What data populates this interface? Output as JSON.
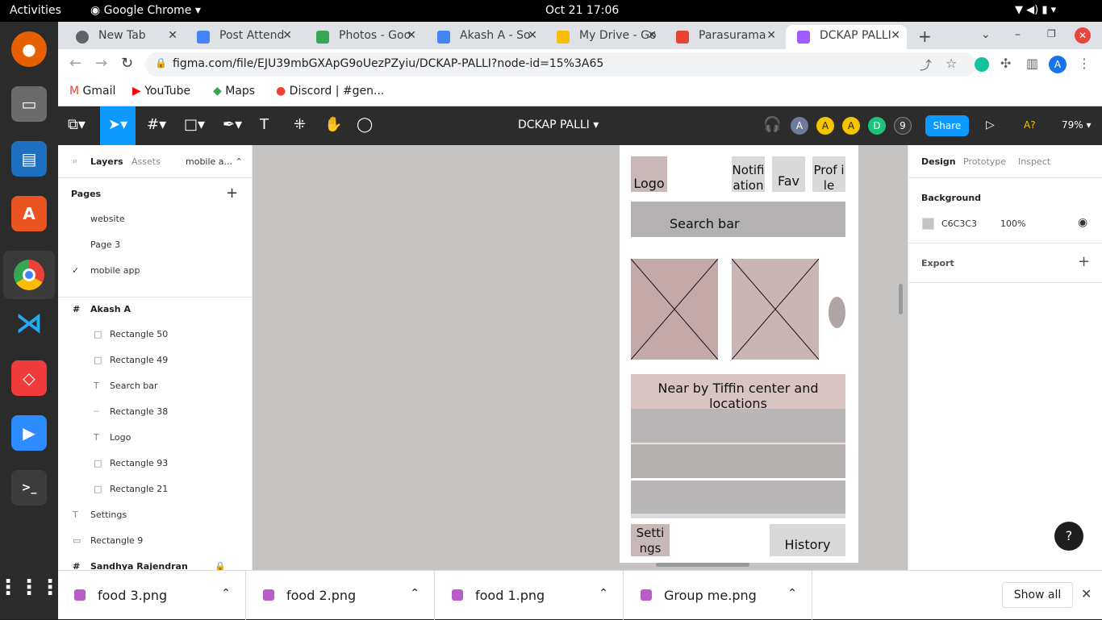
{
  "os": {
    "activities": "Activities",
    "app_menu": "Google Chrome",
    "clock": "Oct 21  17:06"
  },
  "chrome": {
    "tabs": [
      {
        "title": "New Tab",
        "color": "#5f6368"
      },
      {
        "title": "Post Attend",
        "color": "#4285f4"
      },
      {
        "title": "Photos - Goo",
        "color": "#34a853"
      },
      {
        "title": "Akash A - So",
        "color": "#4285f4"
      },
      {
        "title": "My Drive - Go",
        "color": "#fbbc04"
      },
      {
        "title": "Parasurama",
        "color": "#ea4335"
      },
      {
        "title": "DCKAP PALLI",
        "color": "#a259ff"
      }
    ],
    "url": "figma.com/file/EJU39mbGXApG9oUezPZyiu/DCKAP-PALLI?node-id=15%3A65",
    "bookmarks": [
      "Gmail",
      "YouTube",
      "Maps",
      "Discord | #gen..."
    ]
  },
  "figma": {
    "file_name": "DCKAP PALLI",
    "share_label": "Share",
    "zoom": "79%",
    "avatars": [
      "A",
      "A",
      "A",
      "D",
      "9"
    ],
    "help_label": "A?",
    "left": {
      "tab_layers": "Layers",
      "tab_assets": "Assets",
      "page_selector": "mobile a...",
      "pages_heading": "Pages",
      "pages": [
        "website",
        "Page 3",
        "mobile app"
      ],
      "layers": [
        {
          "name": "Akash A",
          "type": "frame"
        },
        {
          "name": "Rectangle 50",
          "type": "rect"
        },
        {
          "name": "Rectangle 49",
          "type": "rect"
        },
        {
          "name": "Search bar",
          "type": "text"
        },
        {
          "name": "Rectangle 38",
          "type": "line"
        },
        {
          "name": "Logo",
          "type": "text"
        },
        {
          "name": "Rectangle 93",
          "type": "rect"
        },
        {
          "name": "Rectangle 21",
          "type": "rect"
        },
        {
          "name": "Settings",
          "type": "text"
        },
        {
          "name": "Rectangle 9",
          "type": "rect"
        },
        {
          "name": "Sandhya Rajendran",
          "type": "frame"
        }
      ]
    },
    "canvas": {
      "logo": "Logo",
      "notification": "Notifi ation",
      "fav": "Fav",
      "profile": "Prof ile",
      "search": "Search bar",
      "nearby": "Near by Tiffin center and locations",
      "settings": "Setti ngs",
      "history": "History"
    },
    "right": {
      "tab_design": "Design",
      "tab_prototype": "Prototype",
      "tab_inspect": "Inspect",
      "background_heading": "Background",
      "bg_hex": "C6C3C3",
      "bg_opacity": "100%",
      "export_heading": "Export"
    },
    "help_button": "?"
  },
  "downloads": {
    "files": [
      "food 3.png",
      "food 2.png",
      "food 1.png",
      "Group me.png"
    ],
    "show_all": "Show all"
  }
}
